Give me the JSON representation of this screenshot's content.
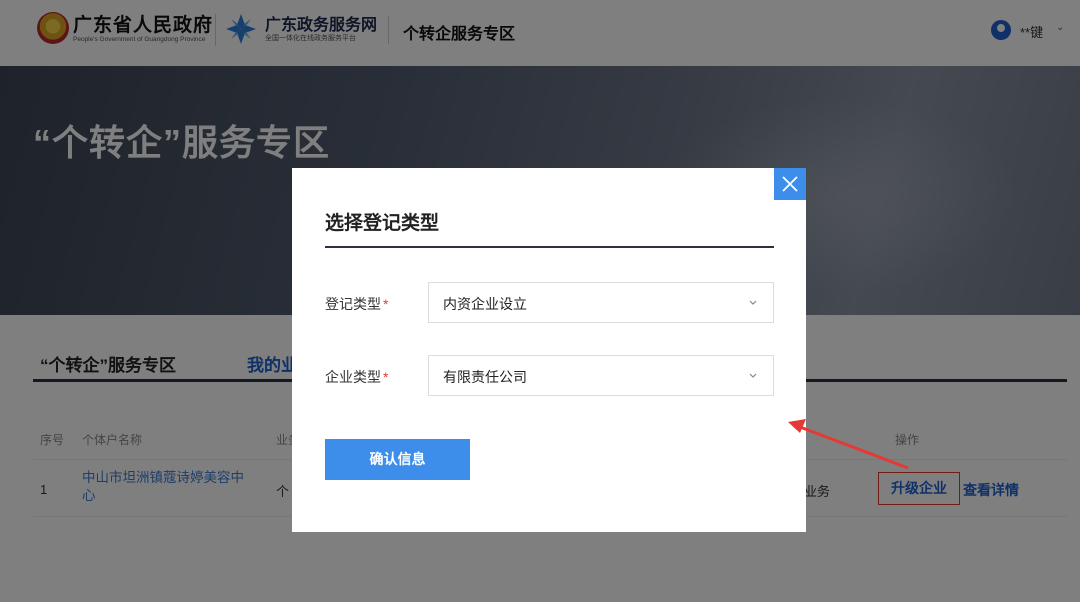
{
  "header": {
    "gov_title": "广东省人民政府",
    "gov_subtitle": "People's Government of Guangdong Province",
    "service_title": "广东政务服务网",
    "service_subtitle": "全国一体化在线政务服务平台",
    "zone_title": "个转企服务专区",
    "user_name": "**键",
    "user_caret": "⌄"
  },
  "banner": {
    "title": "“个转企”服务专区"
  },
  "tabs": [
    {
      "label": "“个转企”服务专区"
    },
    {
      "label": "我的业"
    }
  ],
  "table": {
    "headers": [
      "序号",
      "个体户名称",
      "业务",
      "操作"
    ],
    "row": {
      "seq": "1",
      "name": "中山市坦洲镇蔻诗婷美容中心",
      "biz_partial_left": "个",
      "biz_partial_right": "业务",
      "actions": [
        "升级企业",
        "查看详情"
      ]
    }
  },
  "modal": {
    "title": "选择登记类型",
    "fields": [
      {
        "label": "登记类型",
        "required_mark": "*",
        "value": "内资企业设立"
      },
      {
        "label": "企业类型",
        "required_mark": "*",
        "value": "有限责任公司"
      }
    ],
    "confirm_label": "确认信息"
  },
  "colors": {
    "primary": "#3d8eea",
    "link": "#1e62d0",
    "required": "#e53935",
    "annotation": "#e53935"
  },
  "icons": {
    "close": "close-icon",
    "chevron": "chevron-down-icon",
    "emblem": "national-emblem-icon",
    "service_logo": "service-logo-icon",
    "avatar": "user-avatar-icon"
  }
}
